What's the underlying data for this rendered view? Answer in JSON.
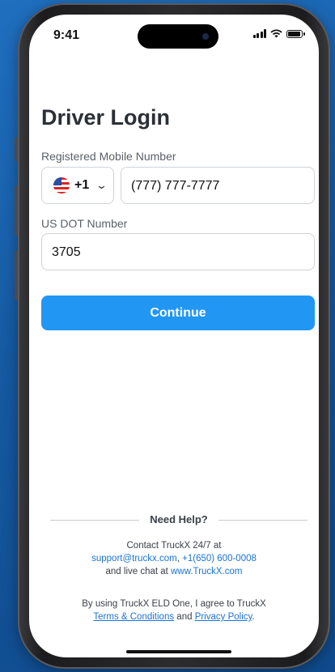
{
  "status_bar": {
    "time": "9:41"
  },
  "login": {
    "title": "Driver Login",
    "mobile_label": "Registered Mobile Number",
    "country_code": "+1",
    "phone_value": "(777) 777-7777",
    "dot_label": "US DOT Number",
    "dot_value": "3705",
    "continue_label": "Continue"
  },
  "help": {
    "heading": "Need Help?",
    "line1": "Contact TruckX 24/7 at",
    "email": "support@truckx.com",
    "sep": ", ",
    "phone": "+1(650) 600-0008",
    "line3_prefix": "and live chat at ",
    "website": "www.TruckX.com",
    "terms_prefix": "By using TruckX ELD One, I agree to TruckX",
    "terms_link": "Terms & Conditions",
    "and": " and ",
    "privacy_link": "Privacy Policy",
    "period": "."
  }
}
